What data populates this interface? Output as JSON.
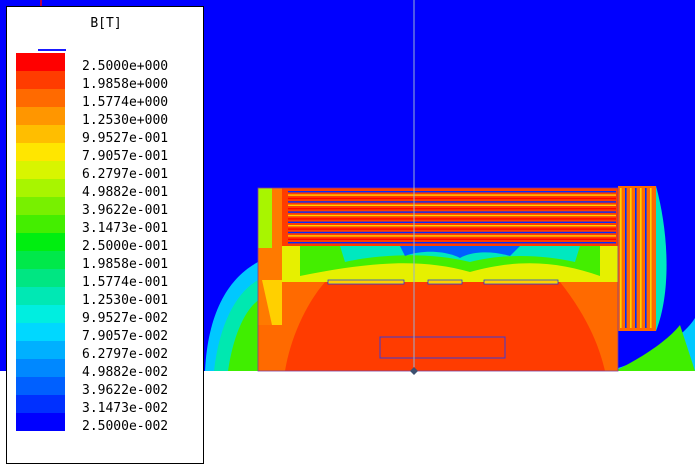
{
  "legend": {
    "title": "B[T]",
    "entries": [
      {
        "label": "2.5000e+000",
        "color": "#ff0000"
      },
      {
        "label": "1.9858e+000",
        "color": "#ff3c00"
      },
      {
        "label": "1.5774e+000",
        "color": "#ff6a00"
      },
      {
        "label": "1.2530e+000",
        "color": "#ff9600"
      },
      {
        "label": "9.9527e-001",
        "color": "#ffbe00"
      },
      {
        "label": "7.9057e-001",
        "color": "#ffe600"
      },
      {
        "label": "6.2797e-001",
        "color": "#d8f500"
      },
      {
        "label": "4.9882e-001",
        "color": "#a8f500"
      },
      {
        "label": "3.9622e-001",
        "color": "#78f000"
      },
      {
        "label": "3.1473e-001",
        "color": "#44ee00"
      },
      {
        "label": "2.5000e-001",
        "color": "#00ee10"
      },
      {
        "label": "1.9858e-001",
        "color": "#00e84a"
      },
      {
        "label": "1.5774e-001",
        "color": "#00e682"
      },
      {
        "label": "1.2530e-001",
        "color": "#00e8b4"
      },
      {
        "label": "9.9527e-002",
        "color": "#00eee0"
      },
      {
        "label": "7.9057e-002",
        "color": "#00d8ff"
      },
      {
        "label": "6.2797e-002",
        "color": "#00b0ff"
      },
      {
        "label": "4.9882e-002",
        "color": "#0088ff"
      },
      {
        "label": "3.9622e-002",
        "color": "#0060ff"
      },
      {
        "label": "3.1473e-002",
        "color": "#0030ff"
      },
      {
        "label": "2.5000e-002",
        "color": "#0000ff"
      }
    ]
  },
  "colors": {
    "background_field": "#0000ff",
    "outline": "#3b3bd6"
  }
}
